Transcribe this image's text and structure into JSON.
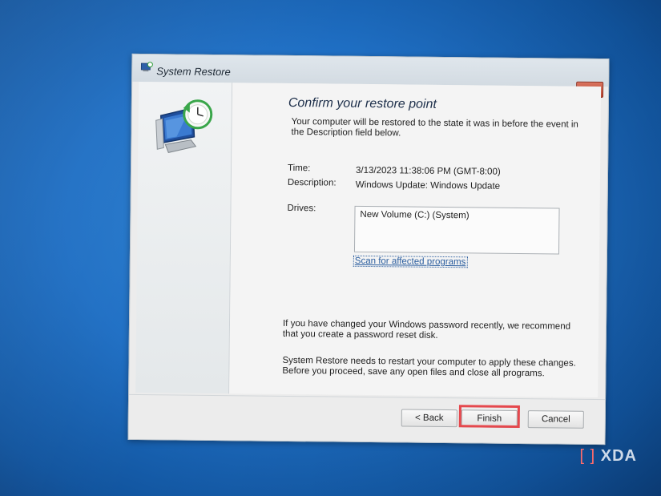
{
  "window": {
    "title": "System Restore",
    "close_label": "×"
  },
  "content": {
    "heading": "Confirm your restore point",
    "intro": "Your computer will be restored to the state it was in before the event in the Description field below.",
    "time_label": "Time:",
    "time_value": "3/13/2023 11:38:06 PM (GMT-8:00)",
    "description_label": "Description:",
    "description_value": "Windows Update: Windows Update",
    "drives_label": "Drives:",
    "drives": [
      "New Volume (C:) (System)"
    ],
    "scan_link": "Scan for affected programs",
    "password_note": "If you have changed your Windows password recently, we recommend that you create a password reset disk.",
    "restart_note": "System Restore needs to restart your computer to apply these changes. Before you proceed, save any open files and close all programs."
  },
  "footer": {
    "back_label": "< Back",
    "finish_label": "Finish",
    "cancel_label": "Cancel"
  },
  "watermark": {
    "text": "XDA",
    "bracket": "[ ]"
  },
  "colors": {
    "highlight": "#e5484d",
    "link": "#2a5d9e",
    "desktop": "#1f6fc4"
  }
}
